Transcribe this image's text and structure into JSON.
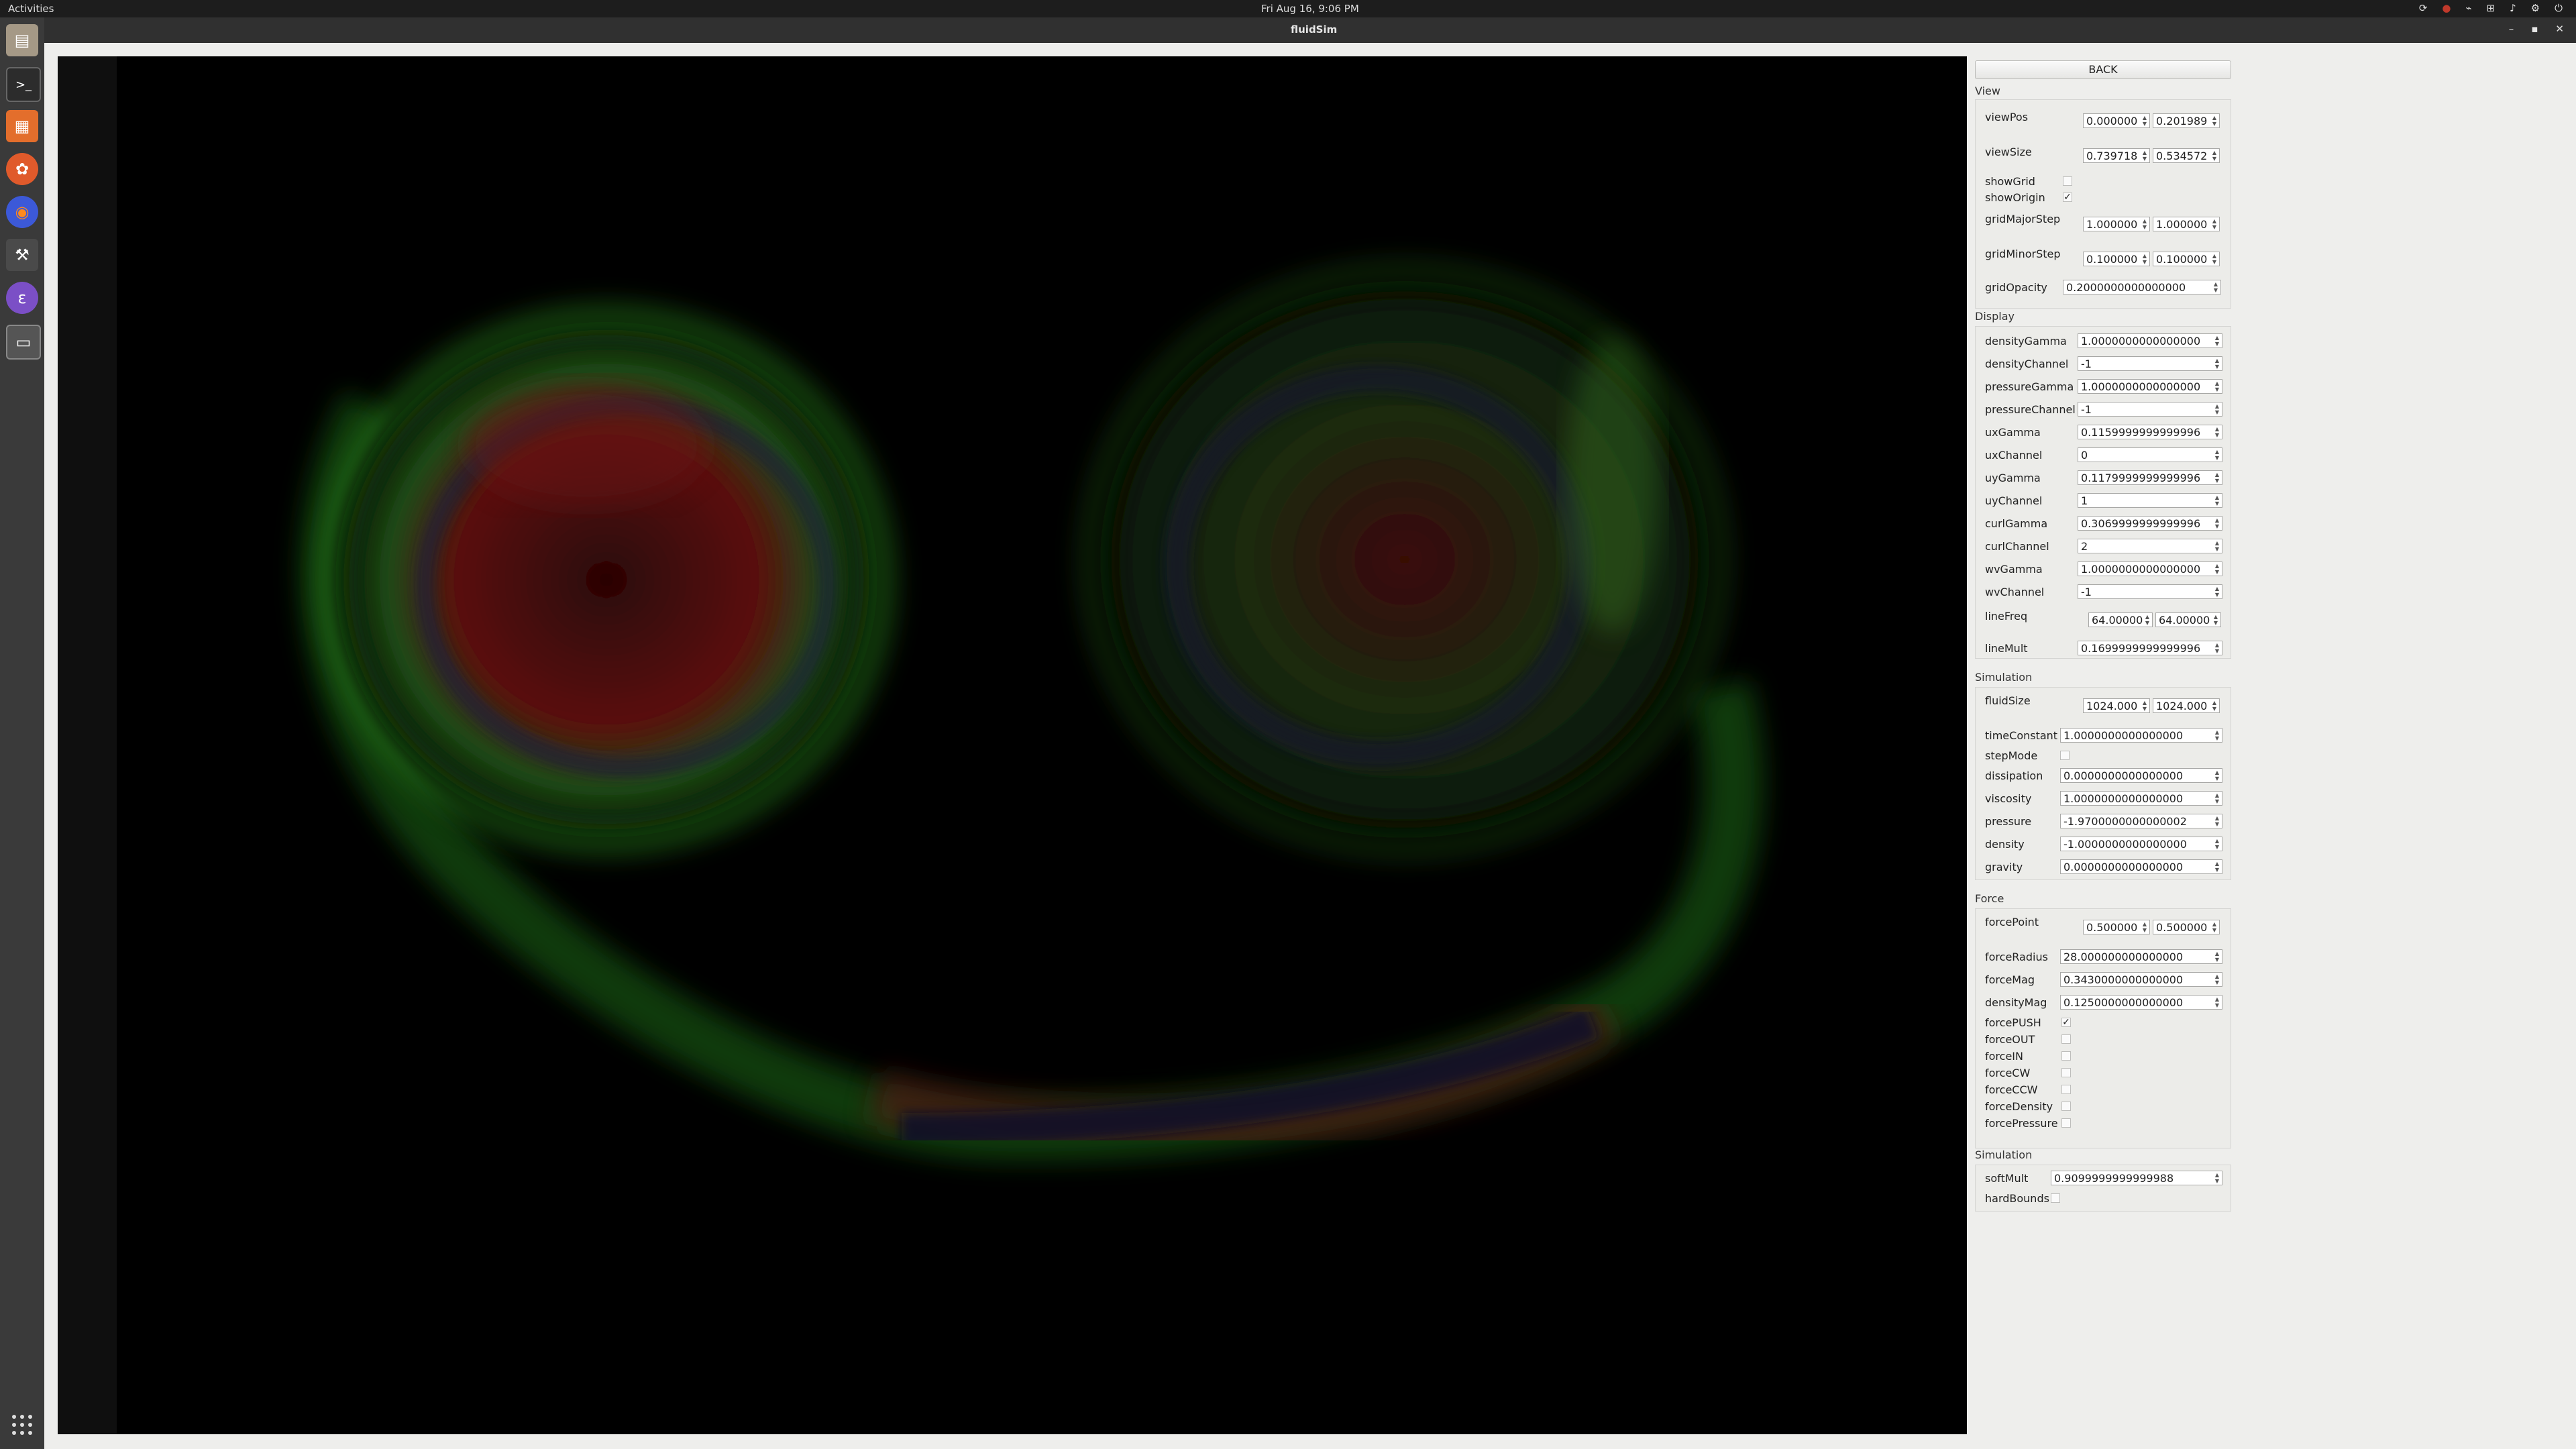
{
  "topbar": {
    "activities": "Activities",
    "clock": "Fri Aug 16,  9:06 PM"
  },
  "window": {
    "title": "fluidSim"
  },
  "dock": {
    "items": [
      "files-icon",
      "terminal-icon",
      "app-icon",
      "software-icon",
      "firefox-icon",
      "tools-icon",
      "emacs-icon",
      "screenshot-icon"
    ]
  },
  "panel": {
    "back": "BACK",
    "view": {
      "title": "View",
      "viewPos": {
        "label": "viewPos",
        "x": "0.000000",
        "y": "0.201989"
      },
      "viewSize": {
        "label": "viewSize",
        "x": "0.739718",
        "y": "0.534572"
      },
      "showGrid": {
        "label": "showGrid",
        "checked": false
      },
      "showOrigin": {
        "label": "showOrigin",
        "checked": true
      },
      "gridMajorStep": {
        "label": "gridMajorStep",
        "x": "1.000000",
        "y": "1.000000"
      },
      "gridMinorStep": {
        "label": "gridMinorStep",
        "x": "0.100000",
        "y": "0.100000"
      },
      "gridOpacity": {
        "label": "gridOpacity",
        "value": "0.2000000000000000"
      }
    },
    "display": {
      "title": "Display",
      "densityGamma": {
        "label": "densityGamma",
        "value": "1.0000000000000000"
      },
      "densityChannel": {
        "label": "densityChannel",
        "value": "-1"
      },
      "pressureGamma": {
        "label": "pressureGamma",
        "value": "1.0000000000000000"
      },
      "pressureChannel": {
        "label": "pressureChannel",
        "value": "-1"
      },
      "uxGamma": {
        "label": "uxGamma",
        "value": "0.1159999999999996"
      },
      "uxChannel": {
        "label": "uxChannel",
        "value": "0"
      },
      "uyGamma": {
        "label": "uyGamma",
        "value": "0.1179999999999996"
      },
      "uyChannel": {
        "label": "uyChannel",
        "value": "1"
      },
      "curlGamma": {
        "label": "curlGamma",
        "value": "0.3069999999999996"
      },
      "curlChannel": {
        "label": "curlChannel",
        "value": "2"
      },
      "wvGamma": {
        "label": "wvGamma",
        "value": "1.0000000000000000"
      },
      "wvChannel": {
        "label": "wvChannel",
        "value": "-1"
      },
      "lineFreq": {
        "label": "lineFreq",
        "x": "64.00000",
        "y": "64.00000"
      },
      "lineMult": {
        "label": "lineMult",
        "value": "0.1699999999999996"
      }
    },
    "simulation": {
      "title": "Simulation",
      "fluidSize": {
        "label": "fluidSize",
        "x": "1024.000",
        "y": "1024.000"
      },
      "timeConstant": {
        "label": "timeConstant",
        "value": "1.0000000000000000"
      },
      "stepMode": {
        "label": "stepMode",
        "checked": false
      },
      "dissipation": {
        "label": "dissipation",
        "value": "0.0000000000000000"
      },
      "viscosity": {
        "label": "viscosity",
        "value": "1.0000000000000000"
      },
      "pressure": {
        "label": "pressure",
        "value": "-1.9700000000000002"
      },
      "density": {
        "label": "density",
        "value": "-1.0000000000000000"
      },
      "gravity": {
        "label": "gravity",
        "value": "0.0000000000000000"
      }
    },
    "force": {
      "title": "Force",
      "forcePoint": {
        "label": "forcePoint",
        "x": "0.500000",
        "y": "0.500000"
      },
      "forceRadius": {
        "label": "forceRadius",
        "value": "28.000000000000000"
      },
      "forceMag": {
        "label": "forceMag",
        "value": "0.3430000000000000"
      },
      "densityMag": {
        "label": "densityMag",
        "value": "0.1250000000000000"
      },
      "forcePUSH": {
        "label": "forcePUSH",
        "checked": true
      },
      "forceOUT": {
        "label": "forceOUT",
        "checked": false
      },
      "forceIN": {
        "label": "forceIN",
        "checked": false
      },
      "forceCW": {
        "label": "forceCW",
        "checked": false
      },
      "forceCCW": {
        "label": "forceCCW",
        "checked": false
      },
      "forceDensity": {
        "label": "forceDensity",
        "checked": false
      },
      "forcePressure": {
        "label": "forcePressure",
        "checked": false
      }
    },
    "simulation2": {
      "title": "Simulation",
      "softMult": {
        "label": "softMult",
        "value": "0.9099999999999988"
      },
      "hardBounds": {
        "label": "hardBounds",
        "checked": false
      }
    }
  }
}
